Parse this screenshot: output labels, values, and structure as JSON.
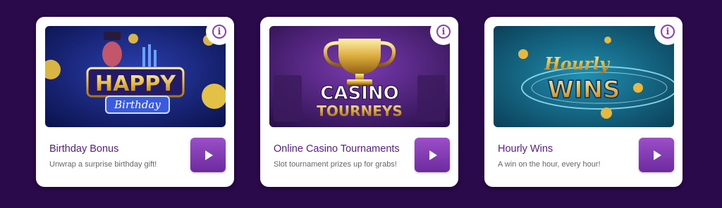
{
  "colors": {
    "page_background": "#2a0a4a",
    "card_background": "#ffffff",
    "title_text": "#5a1a8a",
    "accent_purple": "#8a3fb4"
  },
  "cards": [
    {
      "image_icon": "birthday-promo-image",
      "image_text": {
        "line1": "HAPPY",
        "line2": "Birthday"
      },
      "title": "Birthday Bonus",
      "description": "Unwrap a surprise birthday gift!",
      "info_icon": "info-icon",
      "play_icon": "play-icon"
    },
    {
      "image_icon": "casino-tourneys-promo-image",
      "image_text": {
        "line1": "CASINO",
        "line2": "TOURNEYS"
      },
      "title": "Online Casino Tournaments",
      "description": "Slot tournament prizes up for grabs!",
      "info_icon": "info-icon",
      "play_icon": "play-icon"
    },
    {
      "image_icon": "hourly-wins-promo-image",
      "image_text": {
        "line1": "Hourly",
        "line2": "WINS"
      },
      "title": "Hourly Wins",
      "description": "A win on the hour, every hour!",
      "info_icon": "info-icon",
      "play_icon": "play-icon"
    }
  ]
}
